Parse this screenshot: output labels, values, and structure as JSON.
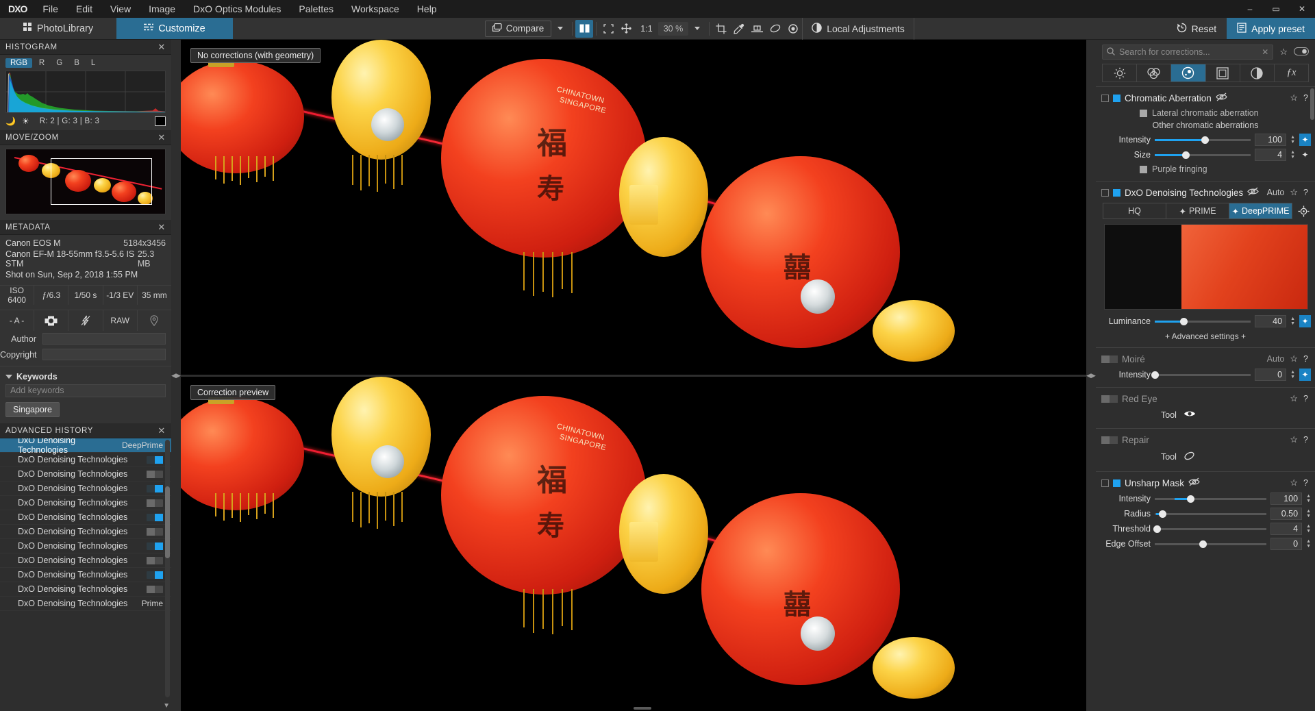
{
  "menu": {
    "logo": "DXO",
    "items": [
      "File",
      "Edit",
      "View",
      "Image",
      "DxO Optics Modules",
      "Palettes",
      "Workspace",
      "Help"
    ],
    "window_buttons": [
      "–",
      "▭",
      "✕"
    ]
  },
  "toolbar": {
    "tabs": [
      {
        "label": "PhotoLibrary",
        "icon": "grid-icon",
        "active": false
      },
      {
        "label": "Customize",
        "icon": "sliders-icon",
        "active": true
      }
    ],
    "compare_label": "Compare",
    "ratio_label": "1:1",
    "zoom_level": "30 %",
    "local_adjustments_label": "Local Adjustments",
    "reset_label": "Reset",
    "apply_preset_label": "Apply preset",
    "icons": [
      "split-view-icon",
      "fit-screen-icon",
      "hand-move-icon",
      "crop-icon",
      "eyedropper-icon",
      "horizon-icon",
      "repair-icon",
      "preview-eye-icon"
    ]
  },
  "left_panel": {
    "histogram": {
      "title": "HISTOGRAM",
      "channels": [
        "RGB",
        "R",
        "G",
        "B",
        "L"
      ],
      "active_channel": "RGB",
      "readout": "R:     2  |  G:     3  |  B:     3",
      "shadow_icon": "moon-icon",
      "highlight_icon": "sun-icon",
      "close": "✕"
    },
    "move_zoom": {
      "title": "MOVE/ZOOM",
      "close": "✕"
    },
    "metadata": {
      "title": "METADATA",
      "close": "✕",
      "camera": "Canon EOS M",
      "dimensions": "5184x3456",
      "lens": "Canon EF-M 18-55mm f3.5-5.6 IS STM",
      "filesize": "25.3 MB",
      "shot_on": "Shot on Sun, Sep 2, 2018 1:55 PM",
      "exif_row1": [
        "ISO 6400",
        "ƒ/6.3",
        "1/50 s",
        "-1/3 EV",
        "35 mm"
      ],
      "exif_row2": [
        "- A -",
        "metering-icon",
        "flash-off-icon",
        "RAW",
        "geotag-icon"
      ],
      "author_label": "Author",
      "author_value": "",
      "copyright_label": "Copyright",
      "copyright_value": "",
      "keywords_title": "Keywords",
      "keywords_placeholder": "Add keywords",
      "keyword_tags": [
        "Singapore"
      ]
    },
    "history": {
      "title": "ADVANCED HISTORY",
      "close": "✕",
      "rows": [
        {
          "label": "DxO Denoising Technologies",
          "value": "DeepPrime",
          "type": "text",
          "selected": true
        },
        {
          "label": "DxO Denoising Technologies",
          "value": "",
          "type": "toggle-on",
          "selected": false
        },
        {
          "label": "DxO Denoising Technologies",
          "value": "",
          "type": "toggle-off",
          "selected": false
        },
        {
          "label": "DxO Denoising Technologies",
          "value": "",
          "type": "toggle-on",
          "selected": false
        },
        {
          "label": "DxO Denoising Technologies",
          "value": "",
          "type": "toggle-off",
          "selected": false
        },
        {
          "label": "DxO Denoising Technologies",
          "value": "",
          "type": "toggle-on",
          "selected": false
        },
        {
          "label": "DxO Denoising Technologies",
          "value": "",
          "type": "toggle-off",
          "selected": false
        },
        {
          "label": "DxO Denoising Technologies",
          "value": "",
          "type": "toggle-on",
          "selected": false
        },
        {
          "label": "DxO Denoising Technologies",
          "value": "",
          "type": "toggle-off",
          "selected": false
        },
        {
          "label": "DxO Denoising Technologies",
          "value": "",
          "type": "toggle-on",
          "selected": false
        },
        {
          "label": "DxO Denoising Technologies",
          "value": "",
          "type": "toggle-off",
          "selected": false
        },
        {
          "label": "DxO Denoising Technologies",
          "value": "Prime",
          "type": "text",
          "selected": false
        }
      ]
    }
  },
  "viewer": {
    "top_label": "No corrections (with geometry)",
    "bottom_label": "Correction preview",
    "image_text_overlays": [
      "CHINATOWN",
      "SINGAPORE"
    ]
  },
  "right_panel": {
    "search_placeholder": "Search for corrections...",
    "search_value": "",
    "tabs": [
      "light-icon",
      "color-icon",
      "detail-icon",
      "geometry-icon",
      "local-icon",
      "fx-icon"
    ],
    "active_tab_index": 2,
    "sections": [
      {
        "name": "Chromatic Aberration",
        "enabled": true,
        "eye_off": true,
        "auto": null,
        "sub_checkbox": "Lateral chromatic aberration",
        "sub_heading": "Other chromatic aberrations",
        "sliders": [
          {
            "label": "Intensity",
            "value": "100",
            "pos": 52,
            "magic": "on"
          },
          {
            "label": "Size",
            "value": "4",
            "pos": 32,
            "magic": "off"
          }
        ],
        "purple_fringing": "Purple fringing"
      },
      {
        "name": "DxO Denoising Technologies",
        "enabled": true,
        "eye_off": true,
        "auto": "Auto",
        "modes": [
          "HQ",
          "PRIME",
          "DeepPRIME"
        ],
        "active_mode": "DeepPRIME",
        "sliders": [
          {
            "label": "Luminance",
            "value": "40",
            "pos": 30,
            "magic": "on"
          }
        ],
        "advanced": "+ Advanced settings +"
      },
      {
        "name": "Moiré",
        "enabled": false,
        "eye_off": false,
        "auto": "Auto",
        "sliders": [
          {
            "label": "Intensity",
            "value": "0",
            "pos": 0,
            "magic": "on"
          }
        ]
      },
      {
        "name": "Red Eye",
        "enabled": false,
        "eye_off": false,
        "auto": null,
        "tool_label": "Tool",
        "tool_icon": "eye-icon"
      },
      {
        "name": "Repair",
        "enabled": false,
        "eye_off": false,
        "auto": null,
        "tool_label": "Tool",
        "tool_icon": "eraser-icon"
      },
      {
        "name": "Unsharp Mask",
        "enabled": true,
        "eye_off": true,
        "auto": null,
        "sliders": [
          {
            "label": "Intensity",
            "value": "100",
            "pos": 32,
            "magic": "none"
          },
          {
            "label": "Radius",
            "value": "0.50",
            "pos": 7,
            "magic": "none"
          },
          {
            "label": "Threshold",
            "value": "4",
            "pos": 2,
            "magic": "none"
          },
          {
            "label": "Edge Offset",
            "value": "0",
            "pos": 43,
            "magic": "none"
          }
        ]
      }
    ]
  },
  "colors": {
    "accent": "#2a6d93",
    "slider": "#1fa2f0",
    "panel": "#2e2e2e",
    "panel_body": "#333333",
    "menubar": "#1c1c1c"
  }
}
